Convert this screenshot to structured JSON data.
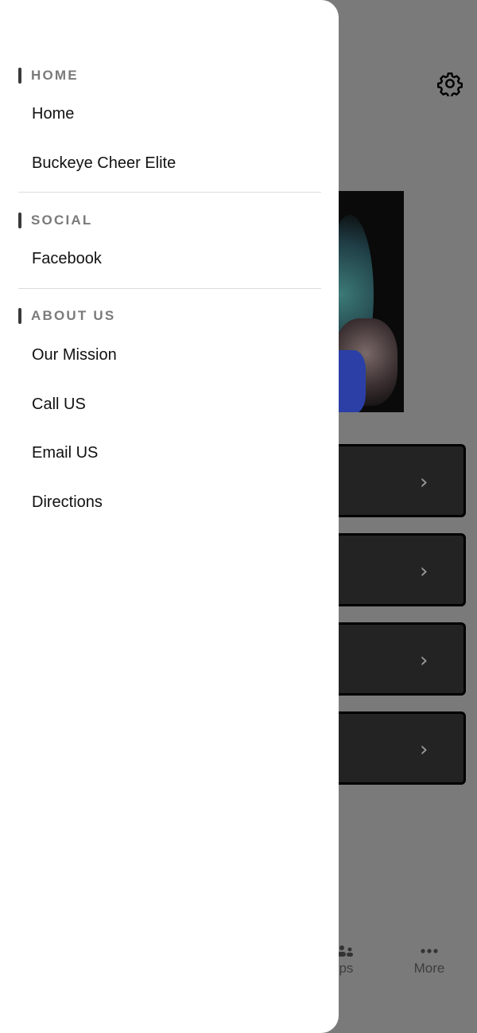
{
  "drawer": {
    "sections": [
      {
        "title": "HOME",
        "items": [
          "Home",
          "Buckeye Cheer Elite"
        ]
      },
      {
        "title": "SOCIAL",
        "items": [
          "Facebook"
        ]
      },
      {
        "title": "ABOUT US",
        "items": [
          "Our Mission",
          "Call US",
          "Email US",
          "Directions"
        ]
      }
    ]
  },
  "background": {
    "tabbar": {
      "groups_label_partial": "ups",
      "more_label": "More"
    },
    "card_chevron": "›"
  },
  "icons": {
    "settings": "gear-icon",
    "chevron": "chevron-right-icon",
    "groups": "groups-icon",
    "more": "more-dots-icon"
  },
  "colors": {
    "overlay": "#7a7a7a",
    "drawer_bg": "#ffffff",
    "section_title": "#7a7a7a",
    "card_bg": "#232323"
  }
}
